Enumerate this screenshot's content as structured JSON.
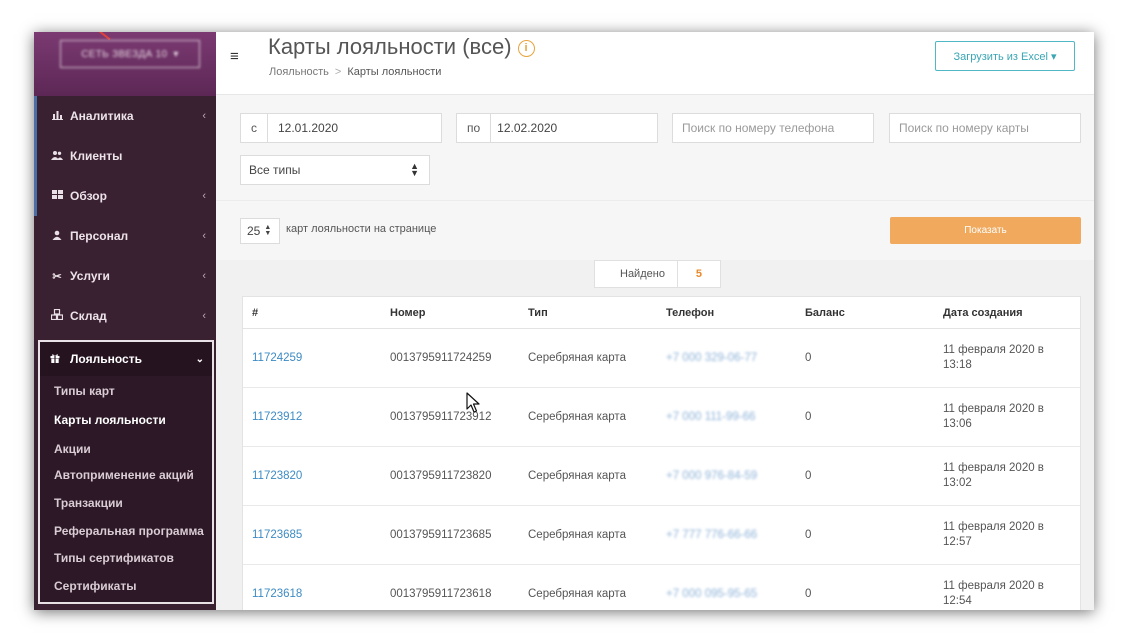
{
  "sidebar": {
    "company_select": "СЕТЬ ЗВЕЗДА 10",
    "items": [
      {
        "label": "Аналитика",
        "icon": "bar-chart-icon",
        "has_arrow": true
      },
      {
        "label": "Клиенты",
        "icon": "users-icon",
        "has_arrow": false
      },
      {
        "label": "Обзор",
        "icon": "grid-icon",
        "has_arrow": true
      },
      {
        "label": "Персонал",
        "icon": "user-icon",
        "has_arrow": true
      },
      {
        "label": "Услуги",
        "icon": "scissors-icon",
        "has_arrow": true
      },
      {
        "label": "Склад",
        "icon": "cubes-icon",
        "has_arrow": true
      }
    ],
    "loyalty": {
      "label": "Лояльность",
      "icon": "gift-icon",
      "items": [
        {
          "label": "Типы карт"
        },
        {
          "label": "Карты лояльности",
          "active": true
        },
        {
          "label": "Акции"
        },
        {
          "label": "Автоприменение акций"
        },
        {
          "label": "Транзакции"
        },
        {
          "label": "Реферальная программа"
        },
        {
          "label": "Типы сертификатов"
        },
        {
          "label": "Сертификаты"
        }
      ]
    },
    "arrow_glyph": "‹"
  },
  "header": {
    "title": "Карты лояльности (все)",
    "info_icon": "i",
    "breadcrumb": [
      "Лояльность",
      "Карты лояльности"
    ],
    "breadcrumb_sep": ">",
    "excel_button": "Загрузить из Excel ▾"
  },
  "filters": {
    "from_label": "с",
    "from_value": "12.01.2020",
    "to_label": "по",
    "to_value": "12.02.2020",
    "phone_placeholder": "Поиск по номеру телефона",
    "card_placeholder": "Поиск по номеру карты",
    "type_select": "Все типы",
    "per_page": "25",
    "per_page_label": "карт лояльности на странице",
    "show_button": "Показать"
  },
  "results": {
    "found_label": "Найдено",
    "found_count": "5"
  },
  "table": {
    "columns": [
      "#",
      "Номер",
      "Тип",
      "Телефон",
      "Баланс",
      "Дата создания"
    ],
    "rows": [
      {
        "id": "11724259",
        "number": "0013795911724259",
        "type": "Серебряная карта",
        "phone": "+7 000 329-06-77",
        "balance": "0",
        "date": "11 февраля 2020 в 13:18"
      },
      {
        "id": "11723912",
        "number": "0013795911723912",
        "type": "Серебряная карта",
        "phone": "+7 000 111-99-66",
        "balance": "0",
        "date": "11 февраля 2020 в 13:06"
      },
      {
        "id": "11723820",
        "number": "0013795911723820",
        "type": "Серебряная карта",
        "phone": "+7 000 976-84-59",
        "balance": "0",
        "date": "11 февраля 2020 в 13:02"
      },
      {
        "id": "11723685",
        "number": "0013795911723685",
        "type": "Серебряная карта",
        "phone": "+7 777 776-66-66",
        "balance": "0",
        "date": "11 февраля 2020 в 12:57"
      },
      {
        "id": "11723618",
        "number": "0013795911723618",
        "type": "Серебряная карта",
        "phone": "+7 000 095-95-65",
        "balance": "0",
        "date": "11 февраля 2020 в 12:54"
      }
    ]
  },
  "colors": {
    "sidebar_bg": "#3a2131",
    "accent_orange": "#f0a95d",
    "link_blue": "#3d8bc4",
    "excel_teal": "#3aa6b3"
  }
}
